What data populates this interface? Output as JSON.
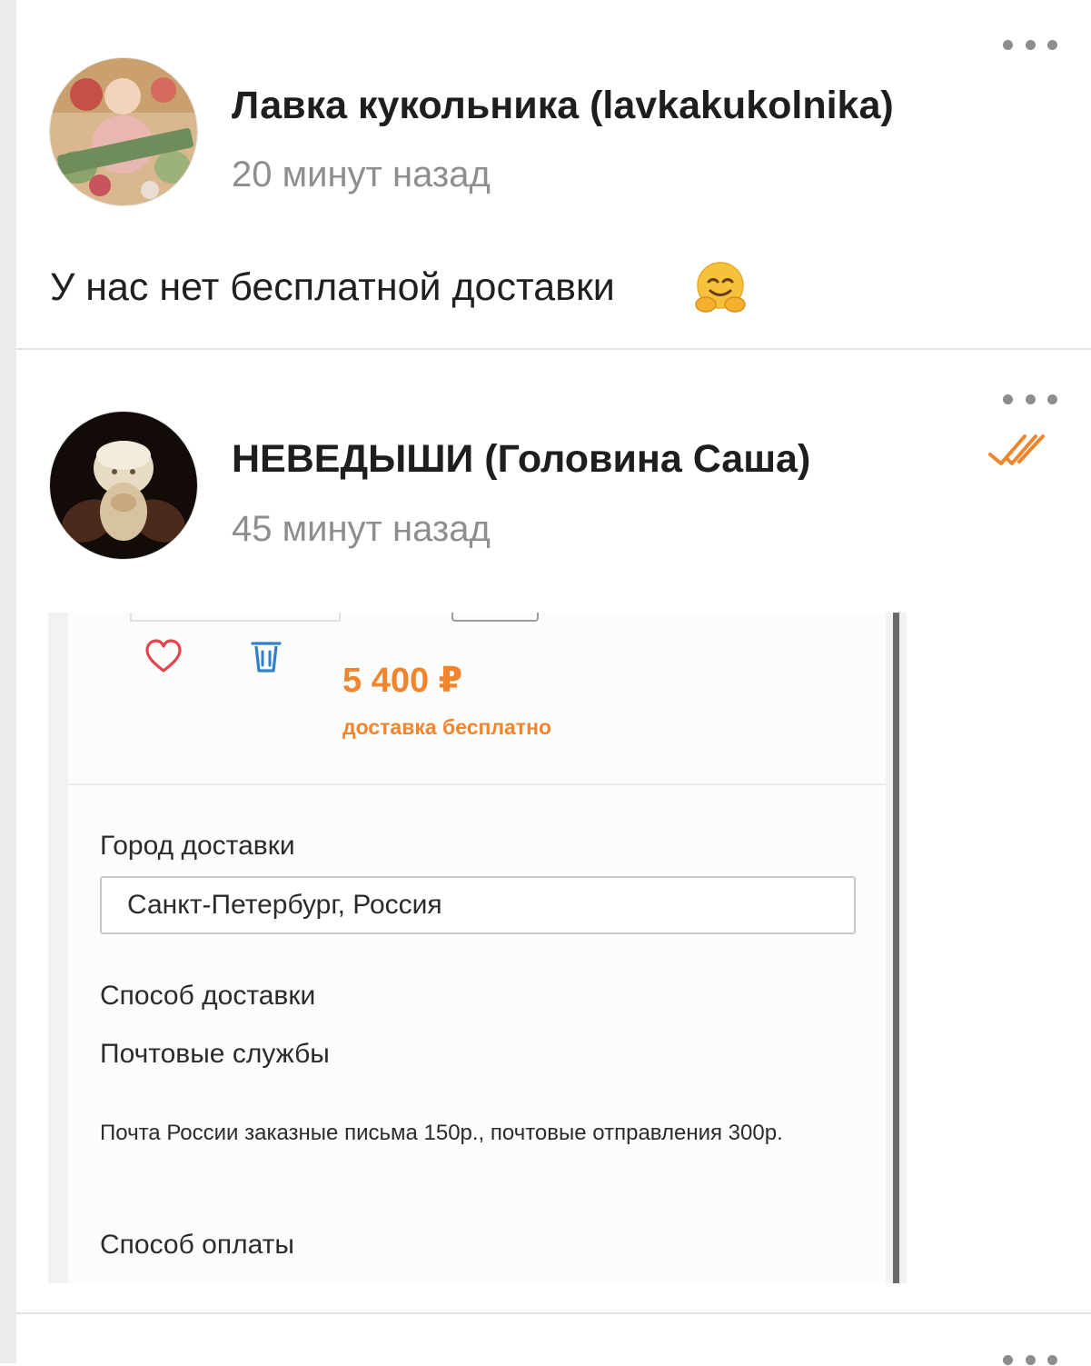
{
  "comments": [
    {
      "author": "Лавка кукольника (lavkakukolnika)",
      "time": "20 минут назад",
      "text": "У нас нет бесплатной доставки",
      "emoji": "hugging-face"
    },
    {
      "author": "НЕВЕДЫШИ (Головина Саша)",
      "time": "45 минут назад",
      "read_status_icon": "double-check-icon",
      "attachment": {
        "price": "5 400 ₽",
        "shipping_note": "доставка бесплатно",
        "city_label": "Город доставки",
        "city_value": "Санкт-Петербург, Россия",
        "delivery_method_label": "Способ доставки",
        "delivery_method_value": "Почтовые службы",
        "delivery_note": "Почта России заказные письма 150р., почтовые отправления 300р.",
        "payment_label": "Способ оплаты"
      }
    }
  ],
  "colors": {
    "accent_orange": "#f0852d",
    "favorite_red": "#e5444e",
    "delete_blue": "#2f7fc9"
  }
}
